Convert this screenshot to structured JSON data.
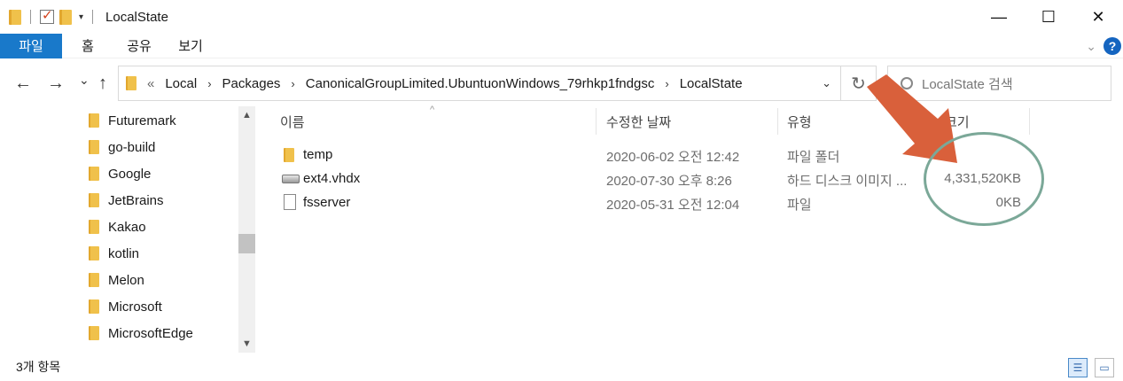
{
  "window": {
    "title": "LocalState",
    "controls": {
      "minimize": "—",
      "maximize": "☐",
      "close": "✕"
    }
  },
  "ribbon": {
    "tabs": [
      "파일",
      "홈",
      "공유",
      "보기"
    ]
  },
  "nav": {
    "back": "←",
    "forward": "→",
    "recent": "⌄",
    "up": "↑",
    "breadcrumb_prefix": "«",
    "breadcrumb": [
      "Local",
      "Packages",
      "CanonicalGroupLimited.UbuntuonWindows_79rhkp1fndgsc",
      "LocalState"
    ],
    "search_placeholder": "LocalState 검색"
  },
  "sidebar": {
    "items": [
      "Futuremark",
      "go-build",
      "Google",
      "JetBrains",
      "Kakao",
      "kotlin",
      "Melon",
      "Microsoft",
      "MicrosoftEdge"
    ]
  },
  "columns": {
    "name": "이름",
    "date": "수정한 날짜",
    "type": "유형",
    "size": "크기"
  },
  "files": [
    {
      "name": "temp",
      "date": "2020-06-02 오전 12:42",
      "type": "파일 폴더",
      "size": "",
      "icon": "folder-icon"
    },
    {
      "name": "ext4.vhdx",
      "date": "2020-07-30 오후 8:26",
      "type": "하드 디스크 이미지 ...",
      "size": "4,331,520KB",
      "icon": "disk-image-icon"
    },
    {
      "name": "fsserver",
      "date": "2020-05-31 오전 12:04",
      "type": "파일",
      "size": "0KB",
      "icon": "file-icon"
    }
  ],
  "status": {
    "count": "3개 항목"
  },
  "colors": {
    "accent": "#1979ca",
    "folder": "#f0c14b",
    "annotation_arrow": "#d9603b",
    "annotation_circle": "#7ba898"
  }
}
